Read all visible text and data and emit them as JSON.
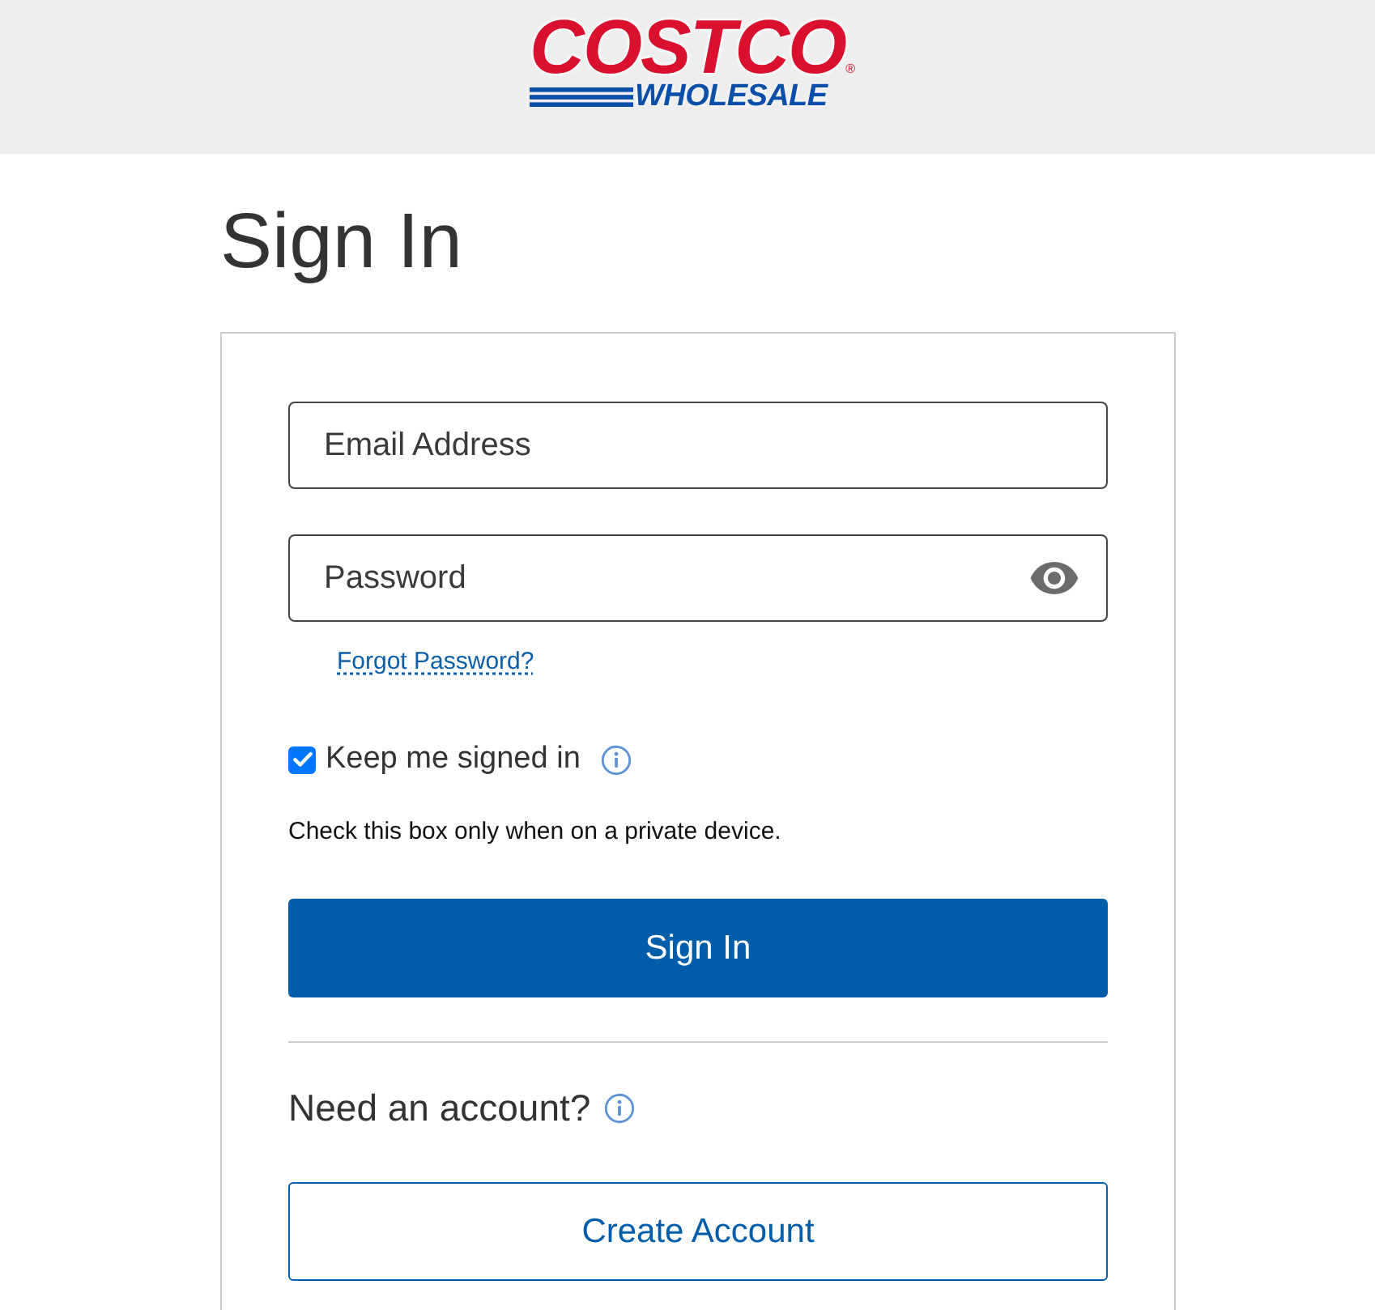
{
  "header": {
    "logo": {
      "top": "COSTCO",
      "registered_mark": "®",
      "bottom": "WHOLESALE"
    }
  },
  "title": "Sign In",
  "form": {
    "fields": [
      {
        "kind": "email",
        "placeholder": "Email Address"
      },
      {
        "kind": "password",
        "placeholder": "Password"
      }
    ],
    "forgot_link": "Forgot Password?",
    "keep_signed_in": {
      "label": "Keep me signed in",
      "checked": true
    },
    "hint": "Check this box only when on a private device.",
    "submit": "Sign In",
    "account": {
      "heading": "Need an account?",
      "button": "Create Account"
    }
  }
}
